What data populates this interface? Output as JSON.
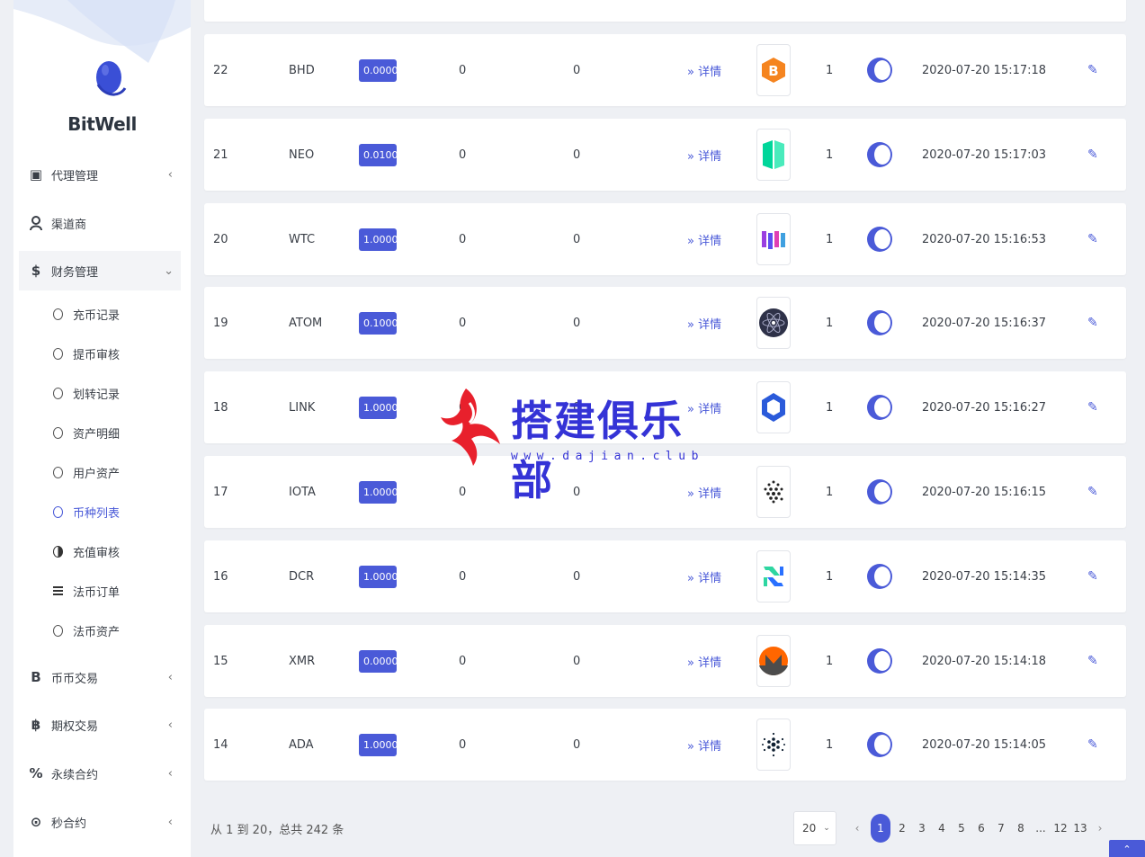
{
  "brand": {
    "name": "BitWell"
  },
  "menu": {
    "items": [
      {
        "label": "代理管理",
        "icon": "id-card-icon",
        "glyph": "▣",
        "chevron": "‹"
      },
      {
        "label": "渠道商",
        "icon": "user-icon",
        "glyph": "",
        "chevron": ""
      },
      {
        "label": "财务管理",
        "icon": "dollar-icon",
        "glyph": "$",
        "chevron": "⌄"
      },
      {
        "label": "币币交易",
        "icon": "bitcoin-b-icon",
        "glyph": "B",
        "chevron": "‹"
      },
      {
        "label": "期权交易",
        "icon": "bitcoin-icon",
        "glyph": "฿",
        "chevron": "‹"
      },
      {
        "label": "永续合约",
        "icon": "percent-icon",
        "glyph": "%",
        "chevron": "‹"
      },
      {
        "label": "秒合约",
        "icon": "target-icon",
        "glyph": "⊙",
        "chevron": "‹"
      }
    ],
    "sub_items": [
      {
        "label": "充币记录"
      },
      {
        "label": "提币审核"
      },
      {
        "label": "划转记录"
      },
      {
        "label": "资产明细"
      },
      {
        "label": "用户资产"
      },
      {
        "label": "币种列表"
      },
      {
        "label": "充值审核"
      },
      {
        "label": "法币订单"
      },
      {
        "label": "法币资产"
      }
    ]
  },
  "table": {
    "rows": [
      {
        "id": "22",
        "symbol": "BHD",
        "fee": "0.0000",
        "a": "0",
        "b": "0",
        "detail": "» 详情",
        "logo": "bhd-logo",
        "flag": "1",
        "time": "2020-07-20 15:17:18"
      },
      {
        "id": "21",
        "symbol": "NEO",
        "fee": "0.0100",
        "a": "0",
        "b": "0",
        "detail": "» 详情",
        "logo": "neo-logo",
        "flag": "1",
        "time": "2020-07-20 15:17:03"
      },
      {
        "id": "20",
        "symbol": "WTC",
        "fee": "1.0000",
        "a": "0",
        "b": "0",
        "detail": "» 详情",
        "logo": "wtc-logo",
        "flag": "1",
        "time": "2020-07-20 15:16:53"
      },
      {
        "id": "19",
        "symbol": "ATOM",
        "fee": "0.1000",
        "a": "0",
        "b": "0",
        "detail": "» 详情",
        "logo": "atom-logo",
        "flag": "1",
        "time": "2020-07-20 15:16:37"
      },
      {
        "id": "18",
        "symbol": "LINK",
        "fee": "1.0000",
        "a": "0",
        "b": "0",
        "detail": "» 详情",
        "logo": "link-logo",
        "flag": "1",
        "time": "2020-07-20 15:16:27"
      },
      {
        "id": "17",
        "symbol": "IOTA",
        "fee": "1.0000",
        "a": "0",
        "b": "0",
        "detail": "» 详情",
        "logo": "iota-logo",
        "flag": "1",
        "time": "2020-07-20 15:16:15"
      },
      {
        "id": "16",
        "symbol": "DCR",
        "fee": "1.0000",
        "a": "0",
        "b": "0",
        "detail": "» 详情",
        "logo": "dcr-logo",
        "flag": "1",
        "time": "2020-07-20 15:14:35"
      },
      {
        "id": "15",
        "symbol": "XMR",
        "fee": "0.0000",
        "a": "0",
        "b": "0",
        "detail": "» 详情",
        "logo": "xmr-logo",
        "flag": "1",
        "time": "2020-07-20 15:14:18"
      },
      {
        "id": "14",
        "symbol": "ADA",
        "fee": "1.0000",
        "a": "0",
        "b": "0",
        "detail": "» 详情",
        "logo": "ada-logo",
        "flag": "1",
        "time": "2020-07-20 15:14:05"
      }
    ]
  },
  "footer": {
    "summary": "从 1 到 20，总共 242 条",
    "page_size": "20",
    "prev": "‹",
    "next": "›",
    "pages": [
      "1",
      "2",
      "3",
      "4",
      "5",
      "6",
      "7",
      "8",
      "...",
      "12",
      "13"
    ],
    "current_page": "1",
    "to_top": "⌃"
  },
  "watermark": {
    "text": "搭建俱乐部",
    "url": "www.dajian.club"
  },
  "colors": {
    "accent": "#4a5ad8",
    "watermark": "#3433d6"
  }
}
